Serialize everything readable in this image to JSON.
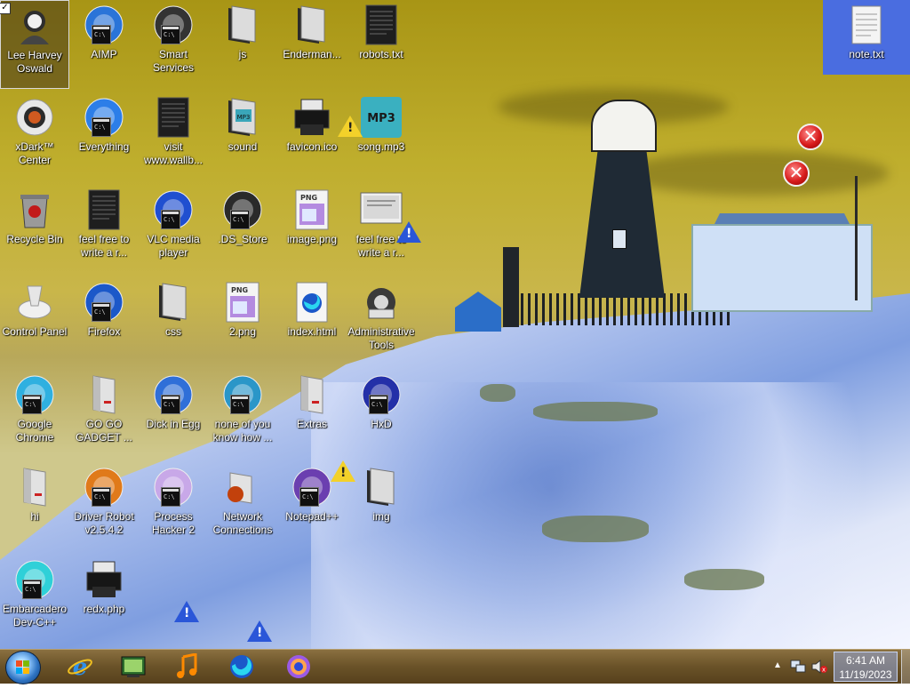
{
  "desktop": {
    "icons": [
      {
        "label": "Lee Harvey Oswald",
        "icon": "user-avatar-icon",
        "selected": true,
        "checkbox": true
      },
      {
        "label": "AIMP",
        "icon": "aimp-icon"
      },
      {
        "label": "Smart Services",
        "icon": "gears-icon"
      },
      {
        "label": "js",
        "icon": "folder-icon"
      },
      {
        "label": "Enderman...",
        "icon": "folder-icon"
      },
      {
        "label": "robots.txt",
        "icon": "text-file-icon"
      },
      {
        "label": "xDark™ Center",
        "icon": "xdark-icon"
      },
      {
        "label": "Everything",
        "icon": "everything-icon"
      },
      {
        "label": "visit www.wallb...",
        "icon": "text-file-icon"
      },
      {
        "label": "sound",
        "icon": "folder-mp3-icon"
      },
      {
        "label": "favicon.ico",
        "icon": "printer-icon"
      },
      {
        "label": "song.mp3",
        "icon": "mp3-icon"
      },
      {
        "label": "Recycle Bin",
        "icon": "recycle-bin-icon"
      },
      {
        "label": "feel free to write a r...",
        "icon": "text-file-icon"
      },
      {
        "label": "VLC media player",
        "icon": "vlc-icon"
      },
      {
        ".label": "",
        "label": ".DS_Store",
        "icon": "store-file-icon"
      },
      {
        "label": "image.png",
        "icon": "png-file-icon"
      },
      {
        "label": "feel free to write a r...",
        "icon": "note-file-icon"
      },
      {
        "label": "Control Panel",
        "icon": "control-panel-icon"
      },
      {
        "label": "Firefox",
        "icon": "firefox-icon"
      },
      {
        "label": "css",
        "icon": "folder-icon"
      },
      {
        "label": "2.png",
        "icon": "png-file-icon"
      },
      {
        "label": "index.html",
        "icon": "html-file-icon"
      },
      {
        "label": "Administrative Tools",
        "icon": "admin-tools-icon"
      },
      {
        "label": "Google Chrome",
        "icon": "chrome-icon"
      },
      {
        "label": "GO GO GADGET ...",
        "icon": "drive-icon"
      },
      {
        "label": "Dick in Egg",
        "icon": "ie-icon"
      },
      {
        "label": "none of you know how ...",
        "icon": "edge-icon"
      },
      {
        "label": "Extras",
        "icon": "drive-icon"
      },
      {
        "label": "HxD",
        "icon": "hxd-icon"
      },
      {
        "label": "hi",
        "icon": "drive-icon"
      },
      {
        "label": "Driver Robot v2.5.4.2",
        "icon": "driver-robot-icon"
      },
      {
        "label": "Process Hacker 2",
        "icon": "process-hacker-icon"
      },
      {
        "label": "Network Connections",
        "icon": "network-icon"
      },
      {
        "label": "Notepad++",
        "icon": "notepadpp-icon"
      },
      {
        "label": "img",
        "icon": "folder-icon"
      },
      {
        "label": "Embarcadero Dev-C++",
        "icon": "devcpp-icon"
      },
      {
        "label": "redx.php",
        "icon": "printer-icon"
      }
    ],
    "note_icon": {
      "label": "note.txt",
      "icon": "text-file-icon"
    },
    "mp3_badge": "MP3",
    "mp3_folder_badge": "MP3",
    "png_badge": "PNG",
    "html_badge": "e"
  },
  "taskbar": {
    "start": "start-orb-icon",
    "pinned": [
      {
        "name": "internet-explorer-icon"
      },
      {
        "name": "media-center-icon"
      },
      {
        "name": "music-note-icon"
      },
      {
        "name": "firefox-icon"
      },
      {
        "name": "chrome-like-icon"
      }
    ],
    "clock": {
      "time": "6:41 AM",
      "date": "11/19/2023"
    }
  },
  "colors": {
    "accent": "#2f74c4",
    "taskbar": "#6a5228",
    "selection": "#4a6de0"
  }
}
